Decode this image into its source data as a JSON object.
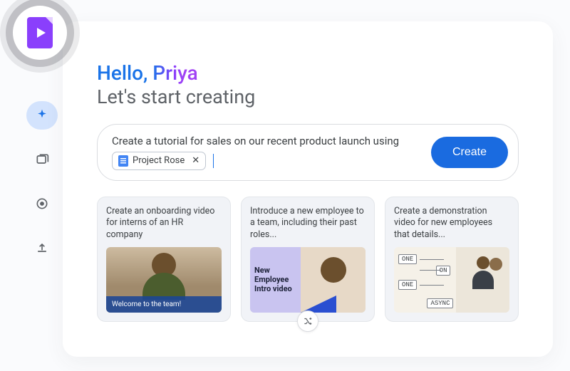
{
  "greeting": {
    "hello": "Hello, ",
    "name": "Priya",
    "subtitle": "Let's start creating"
  },
  "prompt": {
    "text": "Create a tutorial for sales on our recent product launch using",
    "chip_label": "Project Rose",
    "create_label": "Create"
  },
  "sidebar": {
    "items": [
      {
        "name": "sparkle",
        "active": true
      },
      {
        "name": "gallery",
        "active": false
      },
      {
        "name": "record",
        "active": false
      },
      {
        "name": "upload",
        "active": false
      }
    ]
  },
  "suggestions": [
    {
      "title": "Create an onboarding video for interns of an HR company",
      "thumb_caption": "Welcome to the team!"
    },
    {
      "title": "Introduce a new employee to a team, including their past roles...",
      "thumb_caption": "New Employee Intro video"
    },
    {
      "title": "Create a demonstration video for new employees that details...",
      "diagram_nodes": [
        "ONE",
        "ON",
        "ONE",
        "ASYNC"
      ]
    }
  ]
}
